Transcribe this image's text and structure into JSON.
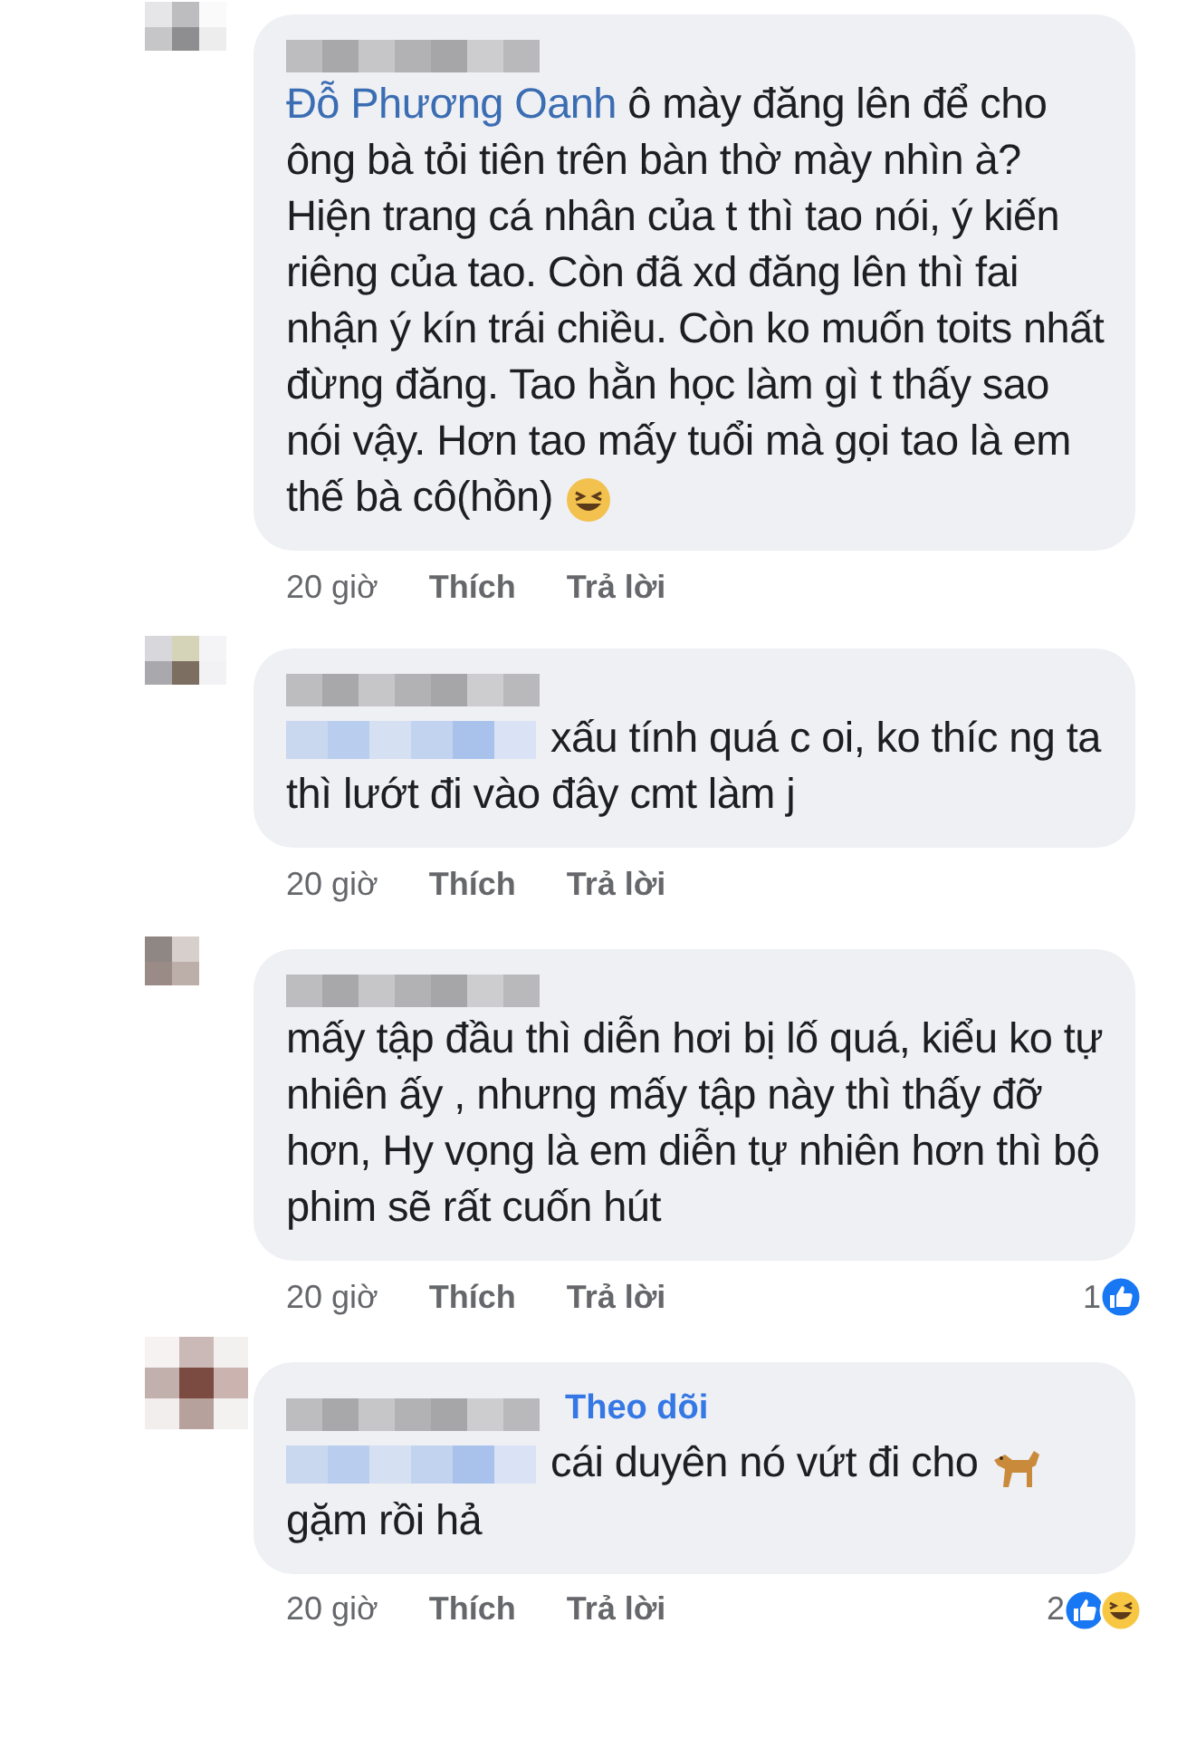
{
  "comments": [
    {
      "kind": "mention",
      "mention": "Đỗ Phương Oanh",
      "text": "ô mày đăng lên để cho ông bà tỏi tiên trên bàn thờ mày nhìn à? Hiện trang cá nhân của t thì tao nói, ý kiến riêng của tao. Còn đã xd đăng lên thì fai nhận ý kín trái chiều. Còn ko muốn toits nhất đừng đăng. Tao hằn học làm gì t thấy sao nói vậy. Hơn tao mấy tuổi mà gọi tao là em thế bà cô(hồn)",
      "end_emoji": {
        "kind": "rofl"
      },
      "time": "20 giờ",
      "like": "Thích",
      "reply": "Trả lời"
    },
    {
      "kind": "tagged",
      "text": "xấu tính quá c oi, ko thíc ng ta thì lướt đi vào đây cmt làm j",
      "time": "20 giờ",
      "like": "Thích",
      "reply": "Trả lời"
    },
    {
      "kind": "plain",
      "text": "mấy tập đầu thì diễn hơi bị lố quá,  kiểu ko tự nhiên ấy  , nhưng mấy tập này thì thấy đỡ hơn,  Hy vọng là em diễn tự nhiên hơn thì bộ phim sẽ rất cuốn hút",
      "time": "20 giờ",
      "like": "Thích",
      "reply": "Trả lời",
      "reactions": {
        "count": "1",
        "kinds": [
          {
            "kind": "like"
          }
        ]
      }
    },
    {
      "kind": "tagged",
      "follow": "Theo dõi",
      "text": "cái duyên nó vứt đi cho",
      "end_emoji": {
        "kind": "dog"
      },
      "text_after": "gặm rồi hả",
      "time": "20 giờ",
      "like": "Thích",
      "reply": "Trả lời",
      "reactions": {
        "count": "2",
        "kinds": [
          {
            "kind": "like"
          },
          {
            "kind": "haha"
          }
        ]
      }
    }
  ]
}
